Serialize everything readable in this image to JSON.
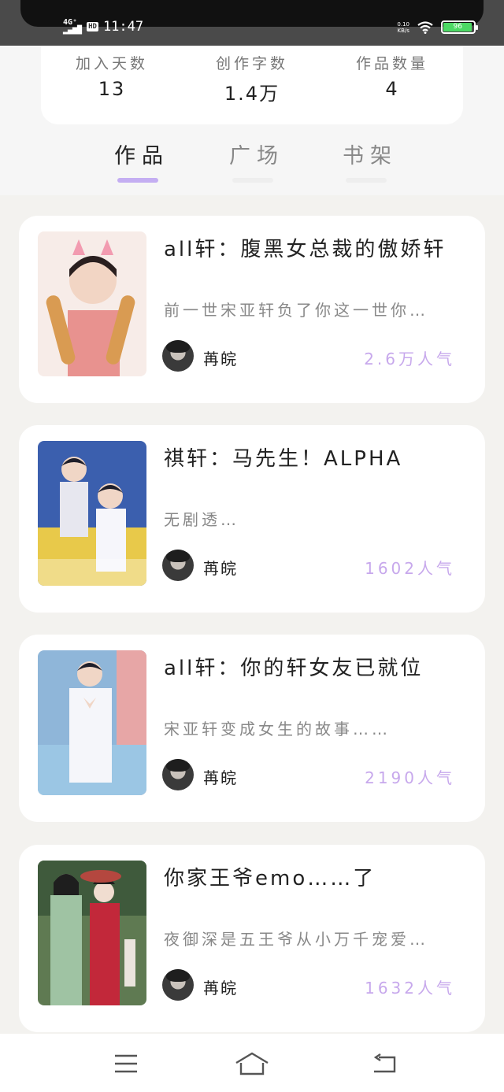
{
  "status_bar": {
    "network": "4G⁺",
    "hd": "HD",
    "time": "11:47",
    "speed_value": "0.10",
    "speed_unit": "KB/s",
    "battery": "96"
  },
  "stats": [
    {
      "label": "加入天数",
      "value": "13"
    },
    {
      "label": "创作字数",
      "value": "1.4万"
    },
    {
      "label": "作品数量",
      "value": "4"
    }
  ],
  "tabs": [
    {
      "label": "作品",
      "active": true
    },
    {
      "label": "广场",
      "active": false
    },
    {
      "label": "书架",
      "active": false
    }
  ],
  "works": [
    {
      "title": "all轩：腹黑女总裁的傲娇轩",
      "desc": "前一世宋亚轩负了你这一世你…",
      "author": "苒皖",
      "popularity": "2.6万人气",
      "cover_text": "all轩：腹黑女总裁的傲娇轩"
    },
    {
      "title": "祺轩：马先生！ALPHA",
      "desc": "无剧透…",
      "author": "苒皖",
      "popularity": "1602人气",
      "cover_text": "祺轩：马先生！ALPHA"
    },
    {
      "title": "all轩：你的轩女友已就位",
      "desc": "宋亚轩变成女生的故事……",
      "author": "苒皖",
      "popularity": "2190人气",
      "cover_text": "all轩：你的轩女友已就位"
    },
    {
      "title": "你家王爷emo……了",
      "desc": "夜御深是五王爷从小万千宠爱…",
      "author": "苒皖",
      "popularity": "1632人气",
      "cover_text": "你家王爷emo……了"
    }
  ],
  "colors": {
    "accent": "#c4aef2",
    "popularity": "#c7a8ec",
    "background": "#f3f2ef"
  },
  "nav_icons": [
    "menu-icon",
    "home-icon",
    "back-icon"
  ]
}
